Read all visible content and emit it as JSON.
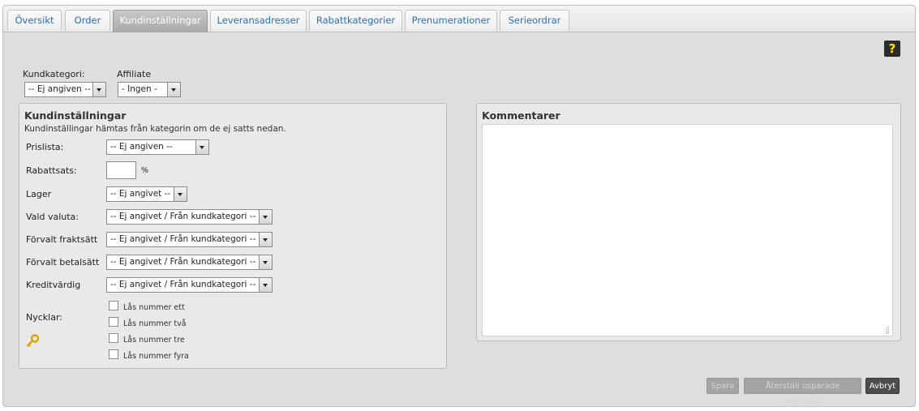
{
  "tabs": [
    {
      "label": "Översikt"
    },
    {
      "label": "Order"
    },
    {
      "label": "Kundinställningar"
    },
    {
      "label": "Leveransadresser"
    },
    {
      "label": "Rabattkategorier"
    },
    {
      "label": "Prenumerationer"
    },
    {
      "label": "Serieordrar"
    }
  ],
  "help_label": "?",
  "top_fields": {
    "customer_category_label": "Kundkategori:",
    "customer_category_value": "-- Ej angiven --",
    "affiliate_label": "Affiliate",
    "affiliate_value": "- Ingen -"
  },
  "settings": {
    "title": "Kundinställningar",
    "subtitle": "Kundinställingar hämtas från kategorin om de ej satts nedan.",
    "rows": [
      {
        "label": "Prislista:",
        "value": "-- Ej angiven --"
      },
      {
        "label": "Rabattsats:",
        "value": "",
        "unit": "%"
      },
      {
        "label": "Lager",
        "value": "-- Ej angivet --"
      },
      {
        "label": "Vald valuta:",
        "value": "-- Ej angivet / Från kundkategori --"
      },
      {
        "label": "Förvalt fraktsätt",
        "value": "-- Ej angivet / Från kundkategori --"
      },
      {
        "label": "Förvalt betalsätt",
        "value": "-- Ej angivet / Från kundkategori --"
      },
      {
        "label": "Kreditvärdig",
        "value": "-- Ej angivet / Från kundkategori --"
      }
    ],
    "keys_label": "Nycklar:",
    "keys": [
      {
        "label": "Lås nummer ett"
      },
      {
        "label": "Lås nummer två"
      },
      {
        "label": "Lås nummer tre"
      },
      {
        "label": "Lås nummer fyra"
      }
    ]
  },
  "comments": {
    "title": "Kommentarer",
    "value": ""
  },
  "buttons": {
    "save": "Spara",
    "reset": "Återställ osparade ändringar",
    "cancel": "Avbryt"
  }
}
